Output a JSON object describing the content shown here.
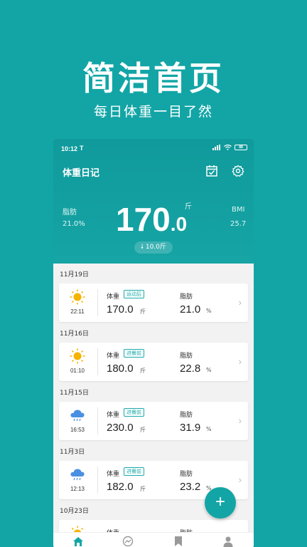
{
  "promo": {
    "title": "简洁首页",
    "subtitle": "每日体重一目了然"
  },
  "status_bar": {
    "time": "10:12",
    "carrier_icon": "T",
    "battery": "88"
  },
  "header": {
    "app_title": "体重日记",
    "calendar_icon": "calendar-check-icon",
    "settings_icon": "gear-icon",
    "fat_label": "脂肪",
    "fat_value": "21.0%",
    "weight_int": "170",
    "weight_dec": ".0",
    "weight_unit": "斤",
    "bmi_label": "BMI",
    "bmi_value": "25.7",
    "diff": "10.0斤"
  },
  "records": [
    {
      "date": "11月19日",
      "time": "22:11",
      "weather": "sunny",
      "weight_label": "体重",
      "tag": "运动后",
      "weight": "170.0",
      "weight_unit": "斤",
      "fat_label": "脂肪",
      "fat": "21.0",
      "fat_unit": "%"
    },
    {
      "date": "11月16日",
      "time": "01:10",
      "weather": "sunny",
      "weight_label": "体重",
      "tag": "进餐前",
      "weight": "180.0",
      "weight_unit": "斤",
      "fat_label": "脂肪",
      "fat": "22.8",
      "fat_unit": "%"
    },
    {
      "date": "11月15日",
      "time": "16:53",
      "weather": "rainy",
      "weight_label": "体重",
      "tag": "进餐前",
      "weight": "230.0",
      "weight_unit": "斤",
      "fat_label": "脂肪",
      "fat": "31.9",
      "fat_unit": "%"
    },
    {
      "date": "11月3日",
      "time": "12:13",
      "weather": "rainy",
      "weight_label": "体重",
      "tag": "进餐前",
      "weight": "182.0",
      "weight_unit": "斤",
      "fat_label": "脂肪",
      "fat": "23.2",
      "fat_unit": "%"
    },
    {
      "date": "10月23日",
      "time": "",
      "weather": "sunny",
      "weight_label": "体重",
      "tag": "",
      "weight": "",
      "weight_unit": "",
      "fat_label": "脂肪",
      "fat": "",
      "fat_unit": ""
    }
  ],
  "fab": {
    "label": "+"
  },
  "tabs": [
    "home-icon",
    "trend-icon",
    "bookmark-icon",
    "profile-icon"
  ],
  "colors": {
    "accent": "#13a5a6",
    "tag": "#1aa9aa",
    "sun": "#f5b400",
    "cloud": "#4a90e2"
  }
}
